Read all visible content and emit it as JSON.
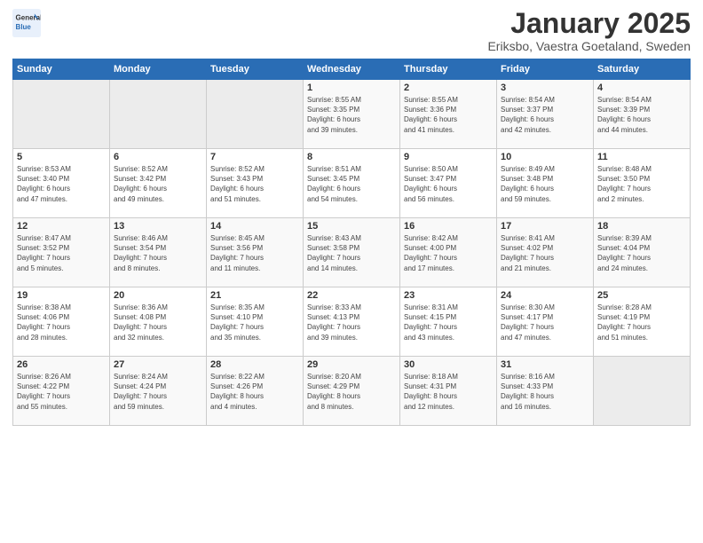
{
  "header": {
    "logo_general": "General",
    "logo_blue": "Blue",
    "title": "January 2025",
    "subtitle": "Eriksbo, Vaestra Goetaland, Sweden"
  },
  "weekdays": [
    "Sunday",
    "Monday",
    "Tuesday",
    "Wednesday",
    "Thursday",
    "Friday",
    "Saturday"
  ],
  "weeks": [
    [
      {
        "day": "",
        "info": ""
      },
      {
        "day": "",
        "info": ""
      },
      {
        "day": "",
        "info": ""
      },
      {
        "day": "1",
        "info": "Sunrise: 8:55 AM\nSunset: 3:35 PM\nDaylight: 6 hours\nand 39 minutes."
      },
      {
        "day": "2",
        "info": "Sunrise: 8:55 AM\nSunset: 3:36 PM\nDaylight: 6 hours\nand 41 minutes."
      },
      {
        "day": "3",
        "info": "Sunrise: 8:54 AM\nSunset: 3:37 PM\nDaylight: 6 hours\nand 42 minutes."
      },
      {
        "day": "4",
        "info": "Sunrise: 8:54 AM\nSunset: 3:39 PM\nDaylight: 6 hours\nand 44 minutes."
      }
    ],
    [
      {
        "day": "5",
        "info": "Sunrise: 8:53 AM\nSunset: 3:40 PM\nDaylight: 6 hours\nand 47 minutes."
      },
      {
        "day": "6",
        "info": "Sunrise: 8:52 AM\nSunset: 3:42 PM\nDaylight: 6 hours\nand 49 minutes."
      },
      {
        "day": "7",
        "info": "Sunrise: 8:52 AM\nSunset: 3:43 PM\nDaylight: 6 hours\nand 51 minutes."
      },
      {
        "day": "8",
        "info": "Sunrise: 8:51 AM\nSunset: 3:45 PM\nDaylight: 6 hours\nand 54 minutes."
      },
      {
        "day": "9",
        "info": "Sunrise: 8:50 AM\nSunset: 3:47 PM\nDaylight: 6 hours\nand 56 minutes."
      },
      {
        "day": "10",
        "info": "Sunrise: 8:49 AM\nSunset: 3:48 PM\nDaylight: 6 hours\nand 59 minutes."
      },
      {
        "day": "11",
        "info": "Sunrise: 8:48 AM\nSunset: 3:50 PM\nDaylight: 7 hours\nand 2 minutes."
      }
    ],
    [
      {
        "day": "12",
        "info": "Sunrise: 8:47 AM\nSunset: 3:52 PM\nDaylight: 7 hours\nand 5 minutes."
      },
      {
        "day": "13",
        "info": "Sunrise: 8:46 AM\nSunset: 3:54 PM\nDaylight: 7 hours\nand 8 minutes."
      },
      {
        "day": "14",
        "info": "Sunrise: 8:45 AM\nSunset: 3:56 PM\nDaylight: 7 hours\nand 11 minutes."
      },
      {
        "day": "15",
        "info": "Sunrise: 8:43 AM\nSunset: 3:58 PM\nDaylight: 7 hours\nand 14 minutes."
      },
      {
        "day": "16",
        "info": "Sunrise: 8:42 AM\nSunset: 4:00 PM\nDaylight: 7 hours\nand 17 minutes."
      },
      {
        "day": "17",
        "info": "Sunrise: 8:41 AM\nSunset: 4:02 PM\nDaylight: 7 hours\nand 21 minutes."
      },
      {
        "day": "18",
        "info": "Sunrise: 8:39 AM\nSunset: 4:04 PM\nDaylight: 7 hours\nand 24 minutes."
      }
    ],
    [
      {
        "day": "19",
        "info": "Sunrise: 8:38 AM\nSunset: 4:06 PM\nDaylight: 7 hours\nand 28 minutes."
      },
      {
        "day": "20",
        "info": "Sunrise: 8:36 AM\nSunset: 4:08 PM\nDaylight: 7 hours\nand 32 minutes."
      },
      {
        "day": "21",
        "info": "Sunrise: 8:35 AM\nSunset: 4:10 PM\nDaylight: 7 hours\nand 35 minutes."
      },
      {
        "day": "22",
        "info": "Sunrise: 8:33 AM\nSunset: 4:13 PM\nDaylight: 7 hours\nand 39 minutes."
      },
      {
        "day": "23",
        "info": "Sunrise: 8:31 AM\nSunset: 4:15 PM\nDaylight: 7 hours\nand 43 minutes."
      },
      {
        "day": "24",
        "info": "Sunrise: 8:30 AM\nSunset: 4:17 PM\nDaylight: 7 hours\nand 47 minutes."
      },
      {
        "day": "25",
        "info": "Sunrise: 8:28 AM\nSunset: 4:19 PM\nDaylight: 7 hours\nand 51 minutes."
      }
    ],
    [
      {
        "day": "26",
        "info": "Sunrise: 8:26 AM\nSunset: 4:22 PM\nDaylight: 7 hours\nand 55 minutes."
      },
      {
        "day": "27",
        "info": "Sunrise: 8:24 AM\nSunset: 4:24 PM\nDaylight: 7 hours\nand 59 minutes."
      },
      {
        "day": "28",
        "info": "Sunrise: 8:22 AM\nSunset: 4:26 PM\nDaylight: 8 hours\nand 4 minutes."
      },
      {
        "day": "29",
        "info": "Sunrise: 8:20 AM\nSunset: 4:29 PM\nDaylight: 8 hours\nand 8 minutes."
      },
      {
        "day": "30",
        "info": "Sunrise: 8:18 AM\nSunset: 4:31 PM\nDaylight: 8 hours\nand 12 minutes."
      },
      {
        "day": "31",
        "info": "Sunrise: 8:16 AM\nSunset: 4:33 PM\nDaylight: 8 hours\nand 16 minutes."
      },
      {
        "day": "",
        "info": ""
      }
    ]
  ]
}
